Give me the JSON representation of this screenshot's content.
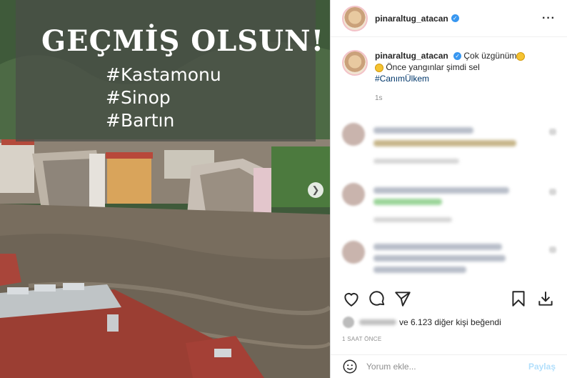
{
  "overlay": {
    "title": "GEÇMİŞ OLSUN!",
    "tags": [
      "#Kastamonu",
      "#Sinop",
      "#Bartın"
    ]
  },
  "post": {
    "username": "pinaraltug_atacan",
    "more_icon": "more-horizontal-icon",
    "caption_part1": "Çok üzgünüm",
    "caption_part2": "Önce yangınlar şimdi sel",
    "hashtag": "#CanımÜlkem",
    "caption_time": "1s"
  },
  "actions": {
    "icons": [
      "heart-icon",
      "comment-icon",
      "share-icon",
      "bookmark-icon",
      "download-icon"
    ]
  },
  "likes": {
    "suffix": "ve 6.123 diğer kişi beğendi"
  },
  "timestamp": "1 SAAT ÖNCE",
  "comment_box": {
    "placeholder": "Yorum ekle...",
    "post_label": "Paylaş"
  },
  "colors": {
    "verified": "#3897f0",
    "hashtag": "#00376b",
    "post_button": "#b2dffc"
  }
}
